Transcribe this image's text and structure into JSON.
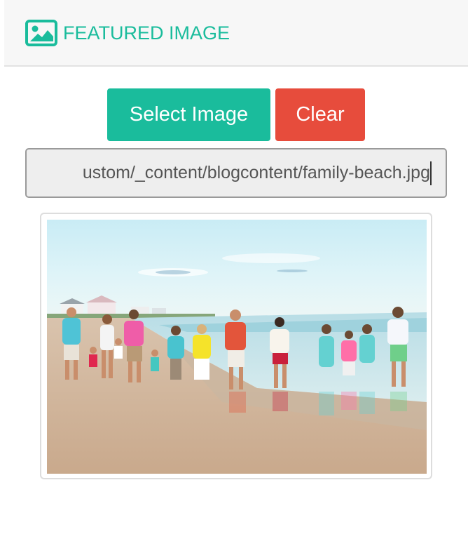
{
  "panel": {
    "title": "FEATURED IMAGE",
    "title_icon": "image-icon",
    "accent_color": "#1abc9c"
  },
  "buttons": {
    "select_label": "Select Image",
    "select_color": "#1abc9c",
    "clear_label": "Clear",
    "clear_color": "#e74c3c"
  },
  "path_input": {
    "value": "ustom/_content/blogcontent/family-beach.jpg"
  },
  "preview": {
    "image_name": "family-beach-photo"
  }
}
